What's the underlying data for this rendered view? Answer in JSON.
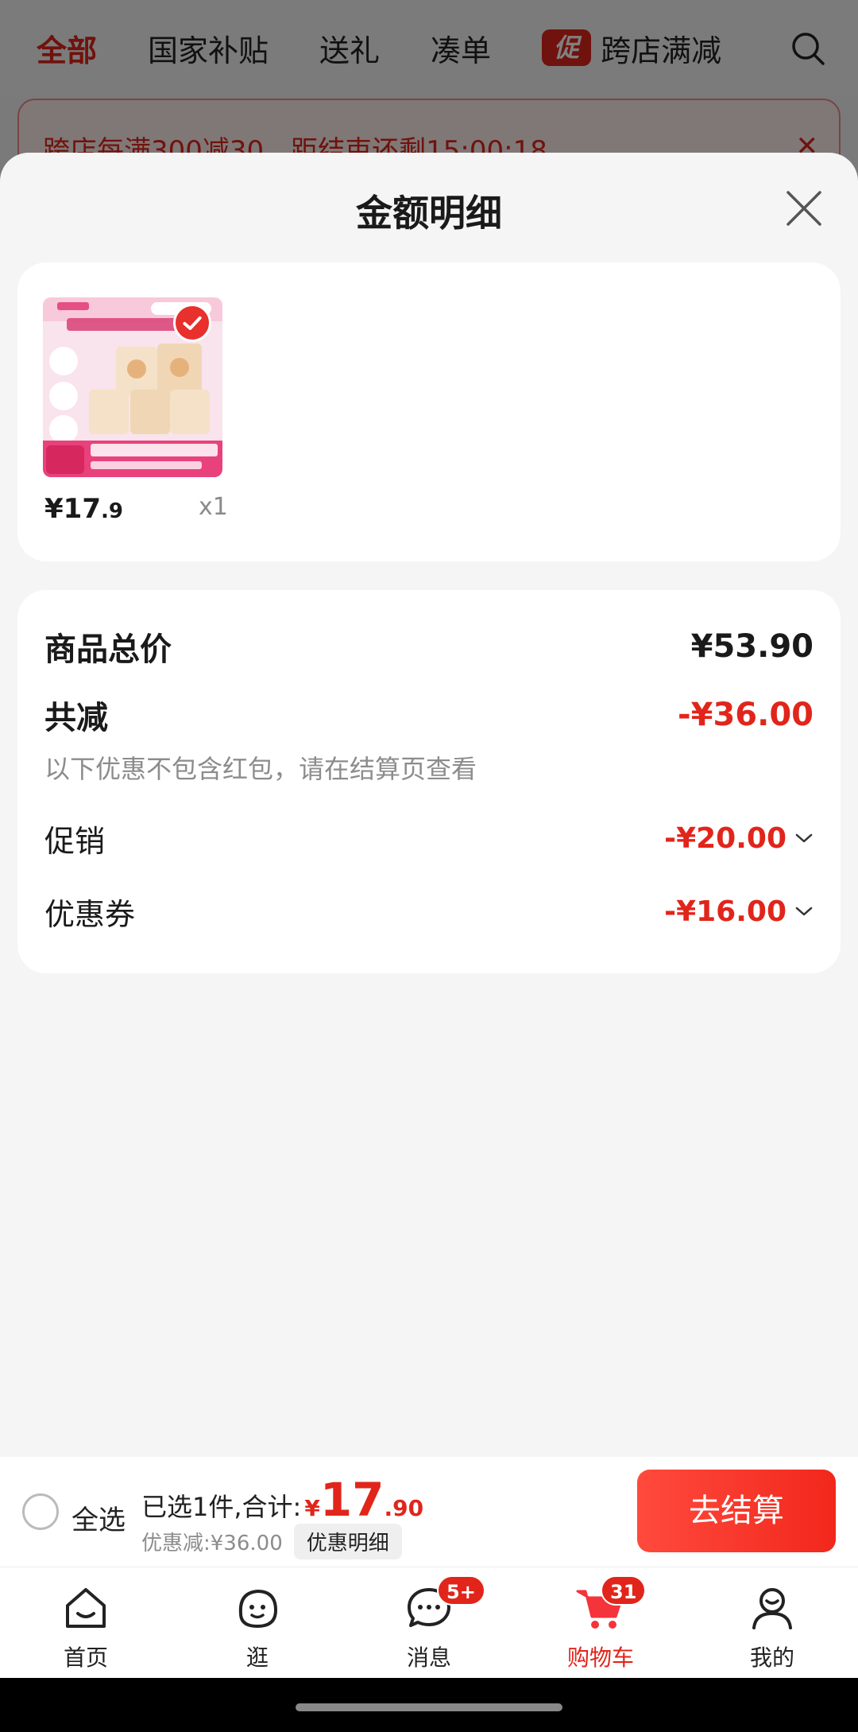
{
  "background": {
    "tabs": [
      "全部",
      "国家补贴",
      "送礼",
      "凑单"
    ],
    "promo_badge": "促",
    "promo_label": "跨店满减",
    "banner_text": "跨店每满300减30，距结束还剩15:00:18"
  },
  "sheet": {
    "title": "金额明细",
    "product": {
      "price_int": "¥17",
      "price_dec": ".9",
      "qty": "x1"
    },
    "details": {
      "total_label": "商品总价",
      "total_value": "¥53.90",
      "reduce_label": "共减",
      "reduce_value": "-¥36.00",
      "note": "以下优惠不包含红包，请在结算页查看",
      "promo_label": "促销",
      "promo_value": "-¥20.00",
      "coupon_label": "优惠券",
      "coupon_value": "-¥16.00"
    }
  },
  "checkout": {
    "select_all": "全选",
    "selected_text": "已选1件,合计:",
    "currency": "¥",
    "total_int": "17",
    "total_dec": ".90",
    "discount_text": "优惠减:¥36.00",
    "discount_detail_btn": "优惠明细",
    "checkout_btn": "去结算"
  },
  "tabbar": {
    "items": [
      {
        "label": "首页",
        "icon": "home-icon"
      },
      {
        "label": "逛",
        "icon": "browse-icon"
      },
      {
        "label": "消息",
        "icon": "message-icon",
        "badge": "5+"
      },
      {
        "label": "购物车",
        "icon": "cart-icon",
        "badge": "31",
        "active": true
      },
      {
        "label": "我的",
        "icon": "profile-icon"
      }
    ]
  },
  "colors": {
    "accent": "#e1251b",
    "muted": "#8c8c8c"
  }
}
